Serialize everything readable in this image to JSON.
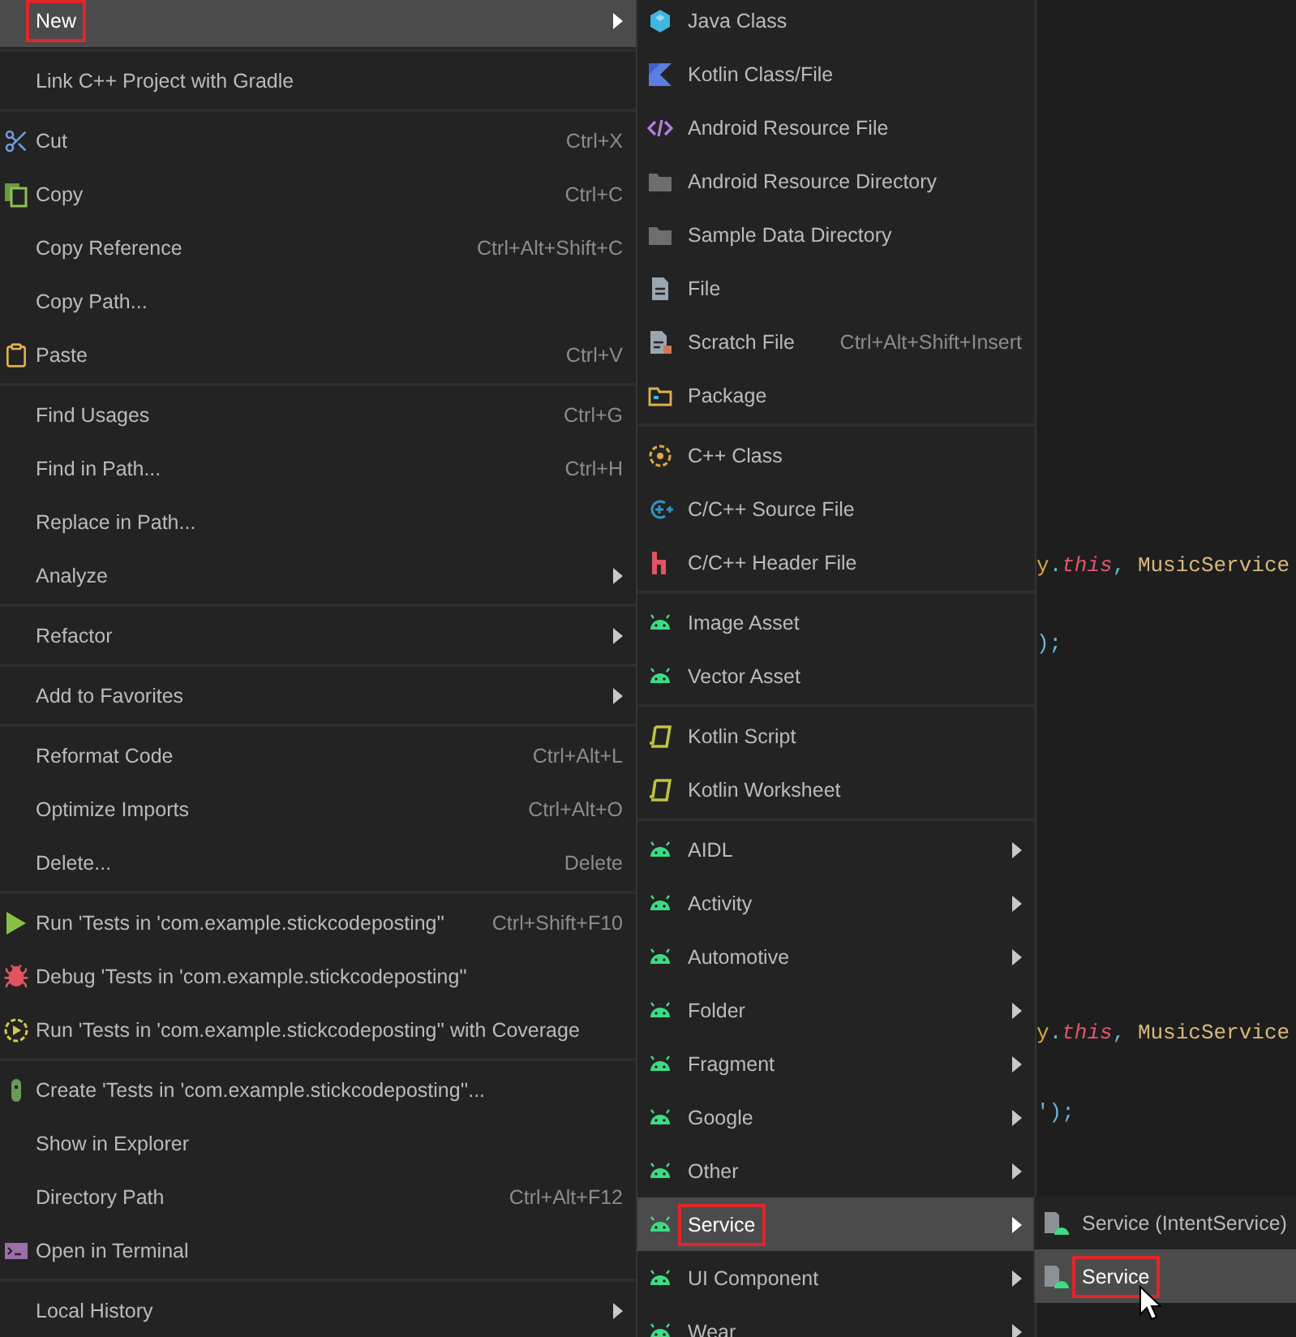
{
  "left_menu": {
    "items": [
      {
        "kind": "item",
        "label": "New",
        "selected": true,
        "annotated": true,
        "submenu": true
      },
      {
        "kind": "separator"
      },
      {
        "kind": "item",
        "label": "Link C++ Project with Gradle",
        "selected": false,
        "annotated": false,
        "submenu": false
      },
      {
        "kind": "separator"
      },
      {
        "kind": "item",
        "label": "Cut",
        "shortcut": "Ctrl+X",
        "selected": false,
        "annotated": false,
        "submenu": false
      },
      {
        "kind": "item",
        "label": "Copy",
        "shortcut": "Ctrl+C",
        "selected": false,
        "annotated": false,
        "submenu": false
      },
      {
        "kind": "item",
        "label": "Copy Reference",
        "shortcut": "Ctrl+Alt+Shift+C",
        "selected": false,
        "annotated": false,
        "submenu": false
      },
      {
        "kind": "item",
        "label": "Copy Path...",
        "selected": false,
        "annotated": false,
        "submenu": false
      },
      {
        "kind": "item",
        "label": "Paste",
        "shortcut": "Ctrl+V",
        "selected": false,
        "annotated": false,
        "submenu": false
      },
      {
        "kind": "separator"
      },
      {
        "kind": "item",
        "label": "Find Usages",
        "shortcut": "Ctrl+G",
        "selected": false,
        "annotated": false,
        "submenu": false
      },
      {
        "kind": "item",
        "label": "Find in Path...",
        "shortcut": "Ctrl+H",
        "selected": false,
        "annotated": false,
        "submenu": false
      },
      {
        "kind": "item",
        "label": "Replace in Path...",
        "selected": false,
        "annotated": false,
        "submenu": false
      },
      {
        "kind": "item",
        "label": "Analyze",
        "selected": false,
        "annotated": false,
        "submenu": true
      },
      {
        "kind": "separator"
      },
      {
        "kind": "item",
        "label": "Refactor",
        "selected": false,
        "annotated": false,
        "submenu": true
      },
      {
        "kind": "separator"
      },
      {
        "kind": "item",
        "label": "Add to Favorites",
        "selected": false,
        "annotated": false,
        "submenu": true
      },
      {
        "kind": "separator"
      },
      {
        "kind": "item",
        "label": "Reformat Code",
        "shortcut": "Ctrl+Alt+L",
        "selected": false,
        "annotated": false,
        "submenu": false
      },
      {
        "kind": "item",
        "label": "Optimize Imports",
        "shortcut": "Ctrl+Alt+O",
        "selected": false,
        "annotated": false,
        "submenu": false
      },
      {
        "kind": "item",
        "label": "Delete...",
        "shortcut": "Delete",
        "selected": false,
        "annotated": false,
        "submenu": false
      },
      {
        "kind": "separator"
      },
      {
        "kind": "item",
        "label": "Run 'Tests in 'com.example.stickcodeposting''",
        "shortcut": "Ctrl+Shift+F10",
        "selected": false,
        "annotated": false,
        "submenu": false
      },
      {
        "kind": "item",
        "label": "Debug 'Tests in 'com.example.stickcodeposting''",
        "selected": false,
        "annotated": false,
        "submenu": false
      },
      {
        "kind": "item",
        "label": "Run 'Tests in 'com.example.stickcodeposting'' with Coverage",
        "selected": false,
        "annotated": false,
        "submenu": false
      },
      {
        "kind": "separator"
      },
      {
        "kind": "item",
        "label": "Create 'Tests in 'com.example.stickcodeposting''...",
        "selected": false,
        "annotated": false,
        "submenu": false
      },
      {
        "kind": "item",
        "label": "Show in Explorer",
        "selected": false,
        "annotated": false,
        "submenu": false
      },
      {
        "kind": "item",
        "label": "Directory Path",
        "shortcut": "Ctrl+Alt+F12",
        "selected": false,
        "annotated": false,
        "submenu": false
      },
      {
        "kind": "item",
        "label": "Open in Terminal",
        "selected": false,
        "annotated": false,
        "submenu": false
      },
      {
        "kind": "separator"
      },
      {
        "kind": "item",
        "label": "Local History",
        "selected": false,
        "annotated": false,
        "submenu": true
      }
    ]
  },
  "new_submenu": {
    "items": [
      {
        "kind": "item",
        "label": "Java Class",
        "selected": false,
        "annotated": false,
        "submenu": false
      },
      {
        "kind": "item",
        "label": "Kotlin Class/File",
        "selected": false,
        "annotated": false,
        "submenu": false
      },
      {
        "kind": "item",
        "label": "Android Resource File",
        "selected": false,
        "annotated": false,
        "submenu": false
      },
      {
        "kind": "item",
        "label": "Android Resource Directory",
        "selected": false,
        "annotated": false,
        "submenu": false
      },
      {
        "kind": "item",
        "label": "Sample Data Directory",
        "selected": false,
        "annotated": false,
        "submenu": false
      },
      {
        "kind": "item",
        "label": "File",
        "selected": false,
        "annotated": false,
        "submenu": false
      },
      {
        "kind": "item",
        "label": "Scratch File",
        "shortcut": "Ctrl+Alt+Shift+Insert",
        "selected": false,
        "annotated": false,
        "submenu": false
      },
      {
        "kind": "item",
        "label": "Package",
        "selected": false,
        "annotated": false,
        "submenu": false
      },
      {
        "kind": "separator"
      },
      {
        "kind": "item",
        "label": "C++ Class",
        "selected": false,
        "annotated": false,
        "submenu": false
      },
      {
        "kind": "item",
        "label": "C/C++ Source File",
        "selected": false,
        "annotated": false,
        "submenu": false
      },
      {
        "kind": "item",
        "label": "C/C++ Header File",
        "selected": false,
        "annotated": false,
        "submenu": false
      },
      {
        "kind": "separator"
      },
      {
        "kind": "item",
        "label": "Image Asset",
        "selected": false,
        "annotated": false,
        "submenu": false
      },
      {
        "kind": "item",
        "label": "Vector Asset",
        "selected": false,
        "annotated": false,
        "submenu": false
      },
      {
        "kind": "separator"
      },
      {
        "kind": "item",
        "label": "Kotlin Script",
        "selected": false,
        "annotated": false,
        "submenu": false
      },
      {
        "kind": "item",
        "label": "Kotlin Worksheet",
        "selected": false,
        "annotated": false,
        "submenu": false
      },
      {
        "kind": "separator"
      },
      {
        "kind": "item",
        "label": "AIDL",
        "selected": false,
        "annotated": false,
        "submenu": true
      },
      {
        "kind": "item",
        "label": "Activity",
        "selected": false,
        "annotated": false,
        "submenu": true
      },
      {
        "kind": "item",
        "label": "Automotive",
        "selected": false,
        "annotated": false,
        "submenu": true
      },
      {
        "kind": "item",
        "label": "Folder",
        "selected": false,
        "annotated": false,
        "submenu": true
      },
      {
        "kind": "item",
        "label": "Fragment",
        "selected": false,
        "annotated": false,
        "submenu": true
      },
      {
        "kind": "item",
        "label": "Google",
        "selected": false,
        "annotated": false,
        "submenu": true
      },
      {
        "kind": "item",
        "label": "Other",
        "selected": false,
        "annotated": false,
        "submenu": true
      },
      {
        "kind": "item",
        "label": "Service",
        "selected": true,
        "annotated": true,
        "submenu": true
      },
      {
        "kind": "item",
        "label": "UI Component",
        "selected": false,
        "annotated": false,
        "submenu": true
      },
      {
        "kind": "item",
        "label": "Wear",
        "selected": false,
        "annotated": false,
        "submenu": true
      }
    ]
  },
  "service_submenu": {
    "items": [
      {
        "kind": "item",
        "label": "Service (IntentService)",
        "selected": false,
        "annotated": false
      },
      {
        "kind": "item",
        "label": "Service",
        "selected": true,
        "annotated": true
      }
    ]
  },
  "editor": {
    "lines": [
      {
        "tokens": [
          {
            "text": "y",
            "kind": "identifier"
          },
          {
            "text": ".",
            "kind": "punct"
          },
          {
            "text": "this",
            "kind": "keyword"
          },
          {
            "text": ", ",
            "kind": "punct"
          },
          {
            "text": "MusicService",
            "kind": "class"
          }
        ]
      },
      {
        "tokens": [
          {
            "text": ");",
            "kind": "punct"
          }
        ]
      },
      {
        "tokens": [
          {
            "text": "y",
            "kind": "identifier"
          },
          {
            "text": ".",
            "kind": "punct"
          },
          {
            "text": "this",
            "kind": "keyword"
          },
          {
            "text": ", ",
            "kind": "punct"
          },
          {
            "text": "MusicService",
            "kind": "class"
          }
        ]
      },
      {
        "tokens": [
          {
            "text": "');",
            "kind": "punct"
          }
        ]
      }
    ]
  }
}
